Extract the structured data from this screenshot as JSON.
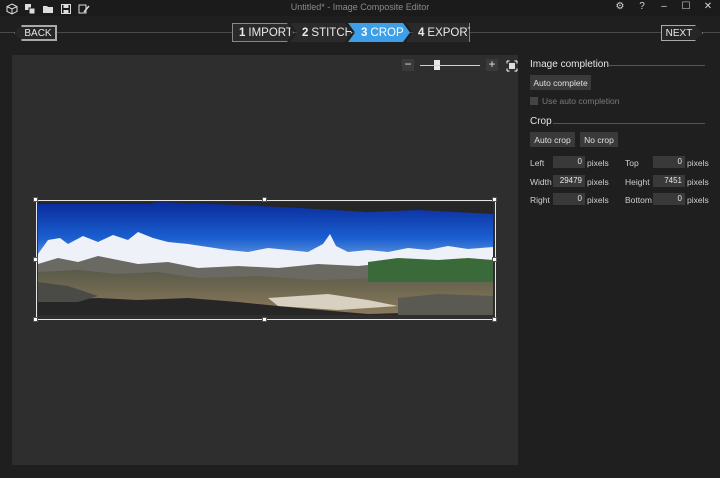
{
  "window": {
    "title": "Untitled* - Image Composite Editor",
    "controls": [
      "⚙",
      "?",
      "–",
      "☐",
      "✕"
    ]
  },
  "toolbar_icons": [
    "new-project-icon",
    "open-images-icon",
    "open-folder-icon",
    "save-icon",
    "save-as-icon"
  ],
  "nav": {
    "back_label": "BACK",
    "next_label": "NEXT",
    "steps": [
      {
        "num": "1",
        "label": "IMPORT",
        "active": false
      },
      {
        "num": "2",
        "label": "STITCH",
        "active": false
      },
      {
        "num": "3",
        "label": "CROP",
        "active": true
      },
      {
        "num": "4",
        "label": "EXPORT",
        "active": false
      }
    ],
    "accent": "#3d9fe8"
  },
  "zoom": {
    "minus": "−",
    "plus": "+"
  },
  "panel": {
    "image_completion": {
      "title": "Image completion",
      "auto_complete_label": "Auto complete",
      "use_auto_label": "Use auto completion"
    },
    "crop": {
      "title": "Crop",
      "auto_crop_label": "Auto crop",
      "no_crop_label": "No crop",
      "left_label": "Left",
      "left_value": "0",
      "top_label": "Top",
      "top_value": "0",
      "width_label": "Width",
      "width_value": "29479",
      "height_label": "Height",
      "height_value": "7451",
      "right_label": "Right",
      "right_value": "0",
      "bottom_label": "Bottom",
      "bottom_value": "0",
      "unit": "pixels"
    }
  }
}
